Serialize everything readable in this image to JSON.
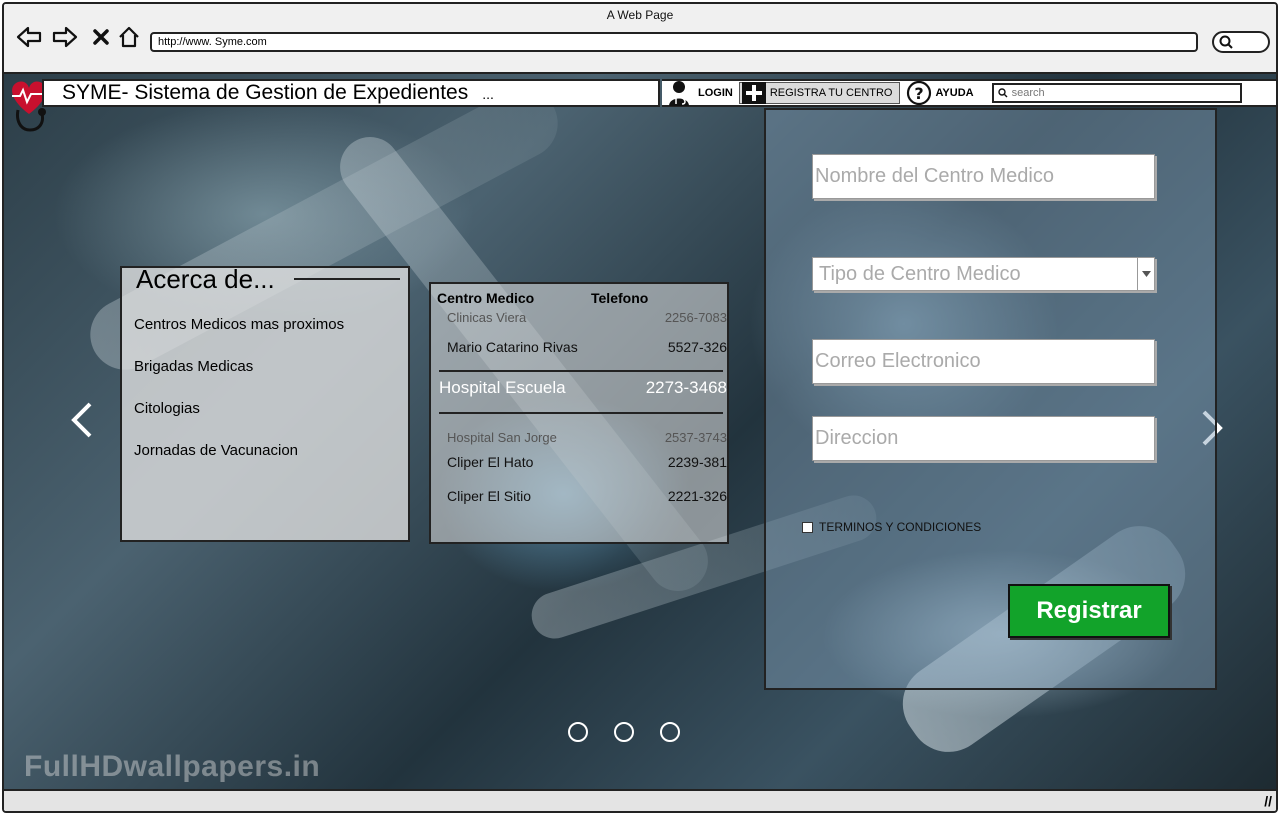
{
  "browser": {
    "window_title": "A Web Page",
    "url": "http://www. Syme.com"
  },
  "header": {
    "title": "SYME- Sistema de Gestion de Expedientes",
    "ellipsis": "...",
    "menu": {
      "login": "LOGIN",
      "registra": "REGISTRA TU CENTRO",
      "ayuda": "AYUDA"
    },
    "search_placeholder": "search"
  },
  "acerca": {
    "title": "Acerca de...",
    "items": [
      "Centros Medicos mas proximos",
      "Brigadas Medicas",
      "Citologias",
      "Jornadas de Vacunacion"
    ]
  },
  "tabla": {
    "headers": {
      "centro": "Centro Medico",
      "telefono": "Telefono"
    },
    "rows": [
      {
        "nombre": "Clinicas Viera",
        "telefono": "2256-7083"
      },
      {
        "nombre": "Mario Catarino Rivas",
        "telefono": "5527-326"
      },
      {
        "nombre": "Hospital Escuela",
        "telefono": "2273-3468"
      },
      {
        "nombre": "Hospital San Jorge",
        "telefono": "2537-3743"
      },
      {
        "nombre": "Cliper El Hato",
        "telefono": "2239-381"
      },
      {
        "nombre": "Cliper El Sitio",
        "telefono": "2221-326"
      }
    ]
  },
  "form": {
    "nombre_placeholder": "Nombre del Centro Medico",
    "tipo_placeholder": "Tipo de Centro Medico",
    "correo_placeholder": "Correo Electronico",
    "direccion_placeholder": "Direccion",
    "terms_label": "TERMINOS Y CONDICIONES",
    "submit_label": "Registrar"
  },
  "background": {
    "watermark": "FullHDwallpapers.in"
  },
  "colors": {
    "accent": "#12a32a",
    "logo_red": "#c8102e"
  },
  "icons": [
    "back-icon",
    "forward-icon",
    "close-icon",
    "home-icon",
    "search-icon",
    "login-icon",
    "plus-icon",
    "help-icon",
    "chevron-left-icon",
    "chevron-right-icon",
    "stethoscope-logo"
  ]
}
